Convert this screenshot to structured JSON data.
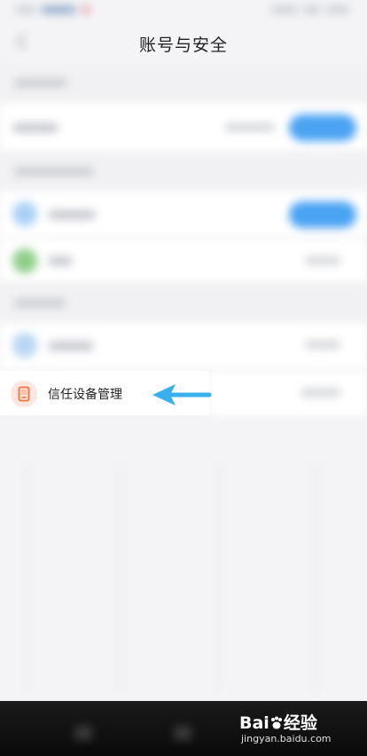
{
  "header": {
    "title": "账号与安全"
  },
  "trusted_device_row": {
    "label": "信任设备管理",
    "icon": "phone-icon"
  },
  "annotation": {
    "arrow_color": "#39b0ee",
    "direction": "left"
  },
  "watermark": {
    "brand": "Bai",
    "brand_suffix": "经验",
    "url": "jingyan.baidu.com"
  },
  "colors": {
    "accent_blue": "#4aa3f3",
    "device_icon_orange": "#f07a4e",
    "background": "#f4f4f6"
  }
}
